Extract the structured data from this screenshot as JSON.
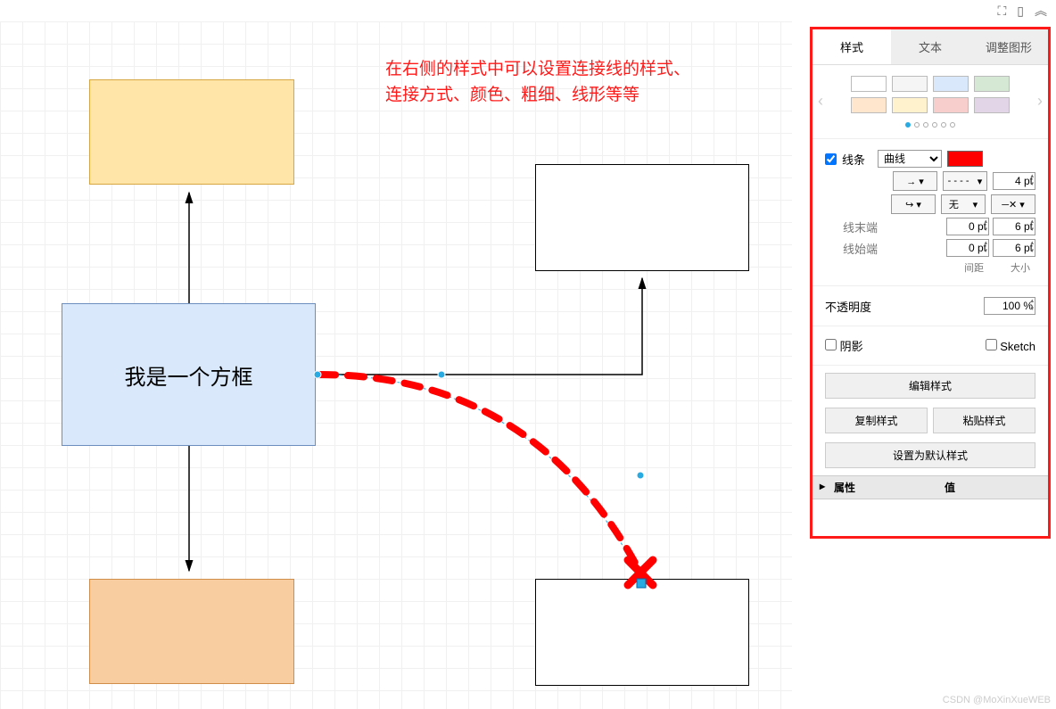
{
  "annotation": "在右侧的样式中可以设置连接线的样式、\n连接方式、颜色、粗细、线形等等",
  "shapes": {
    "box_label": "我是一个方框"
  },
  "panel": {
    "tabs": {
      "style": "样式",
      "text": "文本",
      "arrange": "调整图形"
    },
    "line": {
      "label": "线条",
      "type": "曲线",
      "color": "#ff0000",
      "width": "4 pt",
      "dash_display": "- - - -",
      "waypoint_none": "无",
      "end": {
        "label": "线末端",
        "spacing": "0 pt",
        "size": "6 pt"
      },
      "start": {
        "label": "线始端",
        "spacing": "0 pt",
        "size": "6 pt"
      },
      "spacing_label": "间距",
      "size_label": "大小"
    },
    "opacity": {
      "label": "不透明度",
      "value": "100 %"
    },
    "shadow": "阴影",
    "sketch": "Sketch",
    "edit_style": "编辑样式",
    "copy_style": "复制样式",
    "paste_style": "粘贴样式",
    "set_default": "设置为默认样式",
    "props": {
      "name": "属性",
      "value": "值"
    }
  },
  "watermark": "CSDN @MoXinXueWEB"
}
